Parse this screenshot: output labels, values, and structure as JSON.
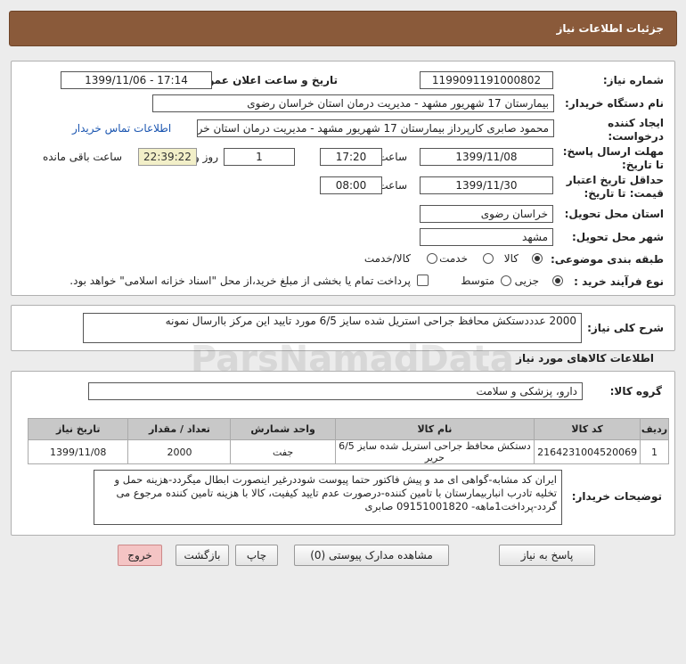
{
  "header": {
    "title": "جزئیات اطلاعات نیاز"
  },
  "form": {
    "need_number_label": "شماره نیاز:",
    "need_number": "1199091191000802",
    "announce_label": "تاریخ و ساعت اعلان عمومی:",
    "announce_value": "1399/11/06 - 17:14",
    "buyer_label": "نام دستگاه خریدار:",
    "buyer_value": "بیمارستان 17 شهریور مشهد - مدیریت درمان استان خراسان رضوی",
    "creator_label1": "ایجاد کننده",
    "creator_label2": "درخواست:",
    "creator_value": "محمود صابری کارپرداز بیمارستان 17 شهریور مشهد - مدیریت درمان استان خراسان رضوی",
    "contact_link": "اطلاعات تماس خریدار",
    "reply_label1": "مهلت ارسال پاسخ:",
    "reply_label2": "تا تاریخ:",
    "reply_date": "1399/11/08",
    "time_label": "ساعت",
    "reply_time": "17:20",
    "days_value": "1",
    "days_label": "روز و",
    "remaining_time": "22:39:22",
    "remaining_label": "ساعت باقی مانده",
    "validity_label1": "حداقل تاریخ اعتبار",
    "validity_label2": "قیمت: تا تاریخ:",
    "validity_date": "1399/11/30",
    "validity_time": "08:00",
    "province_label": "استان محل تحویل:",
    "province_value": "خراسان رضوی",
    "city_label": "شهر محل تحویل:",
    "city_value": "مشهد",
    "category_label": "طبقه بندی موضوعی:",
    "category_options": [
      "کالا",
      "خدمت",
      "کالا/خدمت"
    ],
    "process_label": "نوع فرآیند خرید :",
    "process_options": [
      "جزیی",
      "متوسط"
    ],
    "payment_note": "پرداخت تمام یا بخشی از مبلغ خرید،از محل \"اسناد خزانه اسلامی\" خواهد بود."
  },
  "summary": {
    "label": "شرح کلی نیاز:",
    "value": "2000 عدددستکش محافظ جراحی استریل شده سایز 6/5 مورد تایید این مرکز باارسال نمونه"
  },
  "goods": {
    "section_title": "اطلاعات کالاهای مورد نیاز",
    "group_label": "گروه کالا:",
    "group_value": "دارو، پزشکی و سلامت",
    "table": {
      "headers": [
        "ردیف",
        "کد کالا",
        "نام کالا",
        "واحد شمارش",
        "تعداد / مقدار",
        "تاریخ نیاز"
      ],
      "rows": [
        [
          "1",
          "2164231004520069",
          "دستکش محافظ جراحی استریل شده سایز 6/5 حریر",
          "جفت",
          "2000",
          "1399/11/08"
        ]
      ]
    },
    "buyer_notes_label": "توضیحات خریدار:",
    "buyer_notes": "ایران کد مشابه-گواهی ای مد و پیش فاکتور حتما پیوست شوددرغیر اینصورت ابطال میگردد-هزینه حمل و تخلیه تادرب انباربیمارستان با تامین کننده-درصورت عدم تایید کیفیت، کالا با هزینه تامین کننده مرجوع می گردد-پرداخت1ماهه- 09151001820 صابری"
  },
  "buttons": {
    "reply": "پاسخ به نیاز",
    "attachments": "مشاهده مدارک پیوستی (0)",
    "print": "چاپ",
    "back": "بازگشت",
    "exit": "خروج"
  },
  "watermark": {
    "text": "ParsNamadData"
  }
}
